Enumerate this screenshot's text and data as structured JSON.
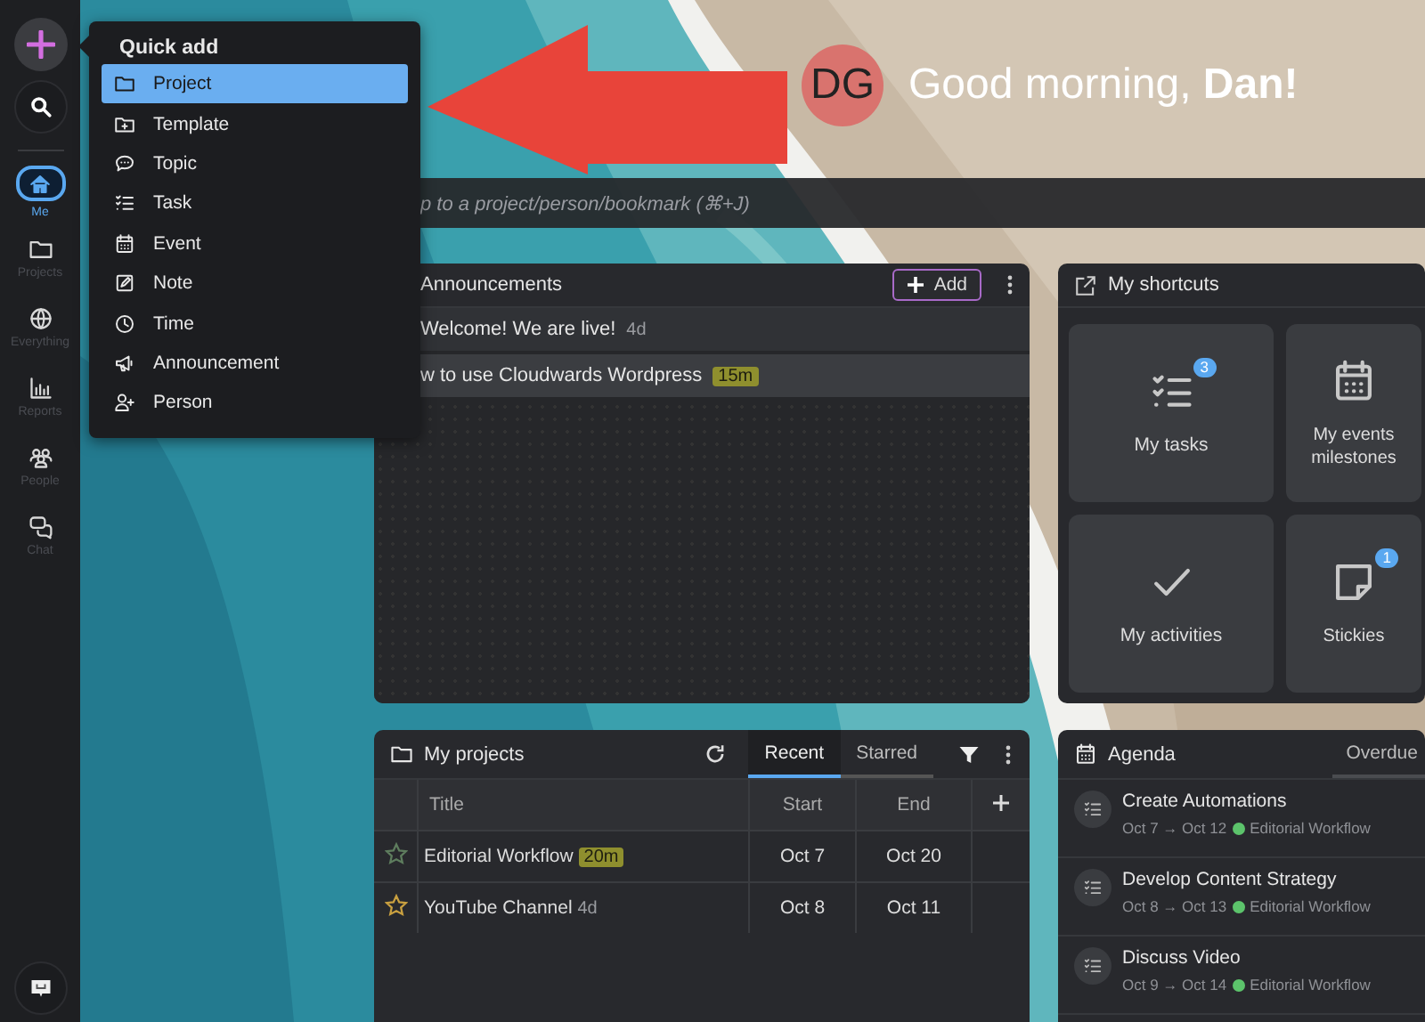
{
  "sidebar": {
    "items": [
      {
        "label": "Me",
        "kind": "home",
        "selected": true
      },
      {
        "label": "Projects",
        "kind": "folder",
        "selected": false
      },
      {
        "label": "Everything",
        "kind": "globe",
        "selected": false
      },
      {
        "label": "Reports",
        "kind": "chart",
        "selected": false
      },
      {
        "label": "People",
        "kind": "people",
        "selected": false
      },
      {
        "label": "Chat",
        "kind": "chat",
        "selected": false
      }
    ]
  },
  "quick_add": {
    "title": "Quick add",
    "items": [
      {
        "label": "Project",
        "kind": "folder",
        "selected": true
      },
      {
        "label": "Template",
        "kind": "template",
        "selected": false
      },
      {
        "label": "Topic",
        "kind": "topic",
        "selected": false
      },
      {
        "label": "Task",
        "kind": "task",
        "selected": false
      },
      {
        "label": "Event",
        "kind": "event",
        "selected": false
      },
      {
        "label": "Note",
        "kind": "note",
        "selected": false
      },
      {
        "label": "Time",
        "kind": "time",
        "selected": false
      },
      {
        "label": "Announcement",
        "kind": "announcement",
        "selected": false
      },
      {
        "label": "Person",
        "kind": "person",
        "selected": false
      }
    ]
  },
  "greeting": {
    "avatar": "DG",
    "text": "Good morning, **Dan!**"
  },
  "search": {
    "placeholder": "p to a project/person/bookmark (⌘+J)"
  },
  "announcements": {
    "title": "Announcements",
    "add_button": "Add",
    "items": [
      {
        "text": "Welcome! We are live!",
        "age": "4d",
        "fresh": false
      },
      {
        "text": "w to use Cloudwards Wordpress",
        "age": "15m",
        "fresh": true
      }
    ]
  },
  "shortcuts": {
    "title": "My shortcuts",
    "tiles": [
      {
        "label": "My tasks",
        "kind": "tasks",
        "badge": "3"
      },
      {
        "label": "My events milestones",
        "kind": "events"
      },
      {
        "label": "My activities",
        "kind": "activities"
      },
      {
        "label": "Stickies",
        "kind": "stickies",
        "badge": "1"
      }
    ]
  },
  "projects": {
    "title": "My projects",
    "tabs": [
      {
        "label": "Recent",
        "selected": true
      },
      {
        "label": "Starred",
        "selected": false
      }
    ],
    "columns": [
      "Title",
      "Start",
      "End"
    ],
    "rows": [
      {
        "title": "Editorial Workflow",
        "age": "20m",
        "fresh": true,
        "start": "Oct 7",
        "end": "Oct 20",
        "color": "#5e7d5e"
      },
      {
        "title": "YouTube Channel",
        "age": "4d",
        "fresh": false,
        "start": "Oct 8",
        "end": "Oct 11",
        "color": "#c9a040"
      }
    ]
  },
  "agenda": {
    "title": "Agenda",
    "tab": "Overdue",
    "items": [
      {
        "title": "Create Automations",
        "dates": "Oct 7 → Oct 12",
        "project": "Editorial Workflow",
        "color": "#5cc36b"
      },
      {
        "title": "Develop Content Strategy",
        "dates": "Oct 8 → Oct 13",
        "project": "Editorial Workflow",
        "color": "#5cc36b"
      },
      {
        "title": "Discuss Video",
        "dates": "Oct 9 → Oct 14",
        "project": "Editorial Workflow",
        "color": "#5cc36b"
      }
    ]
  }
}
